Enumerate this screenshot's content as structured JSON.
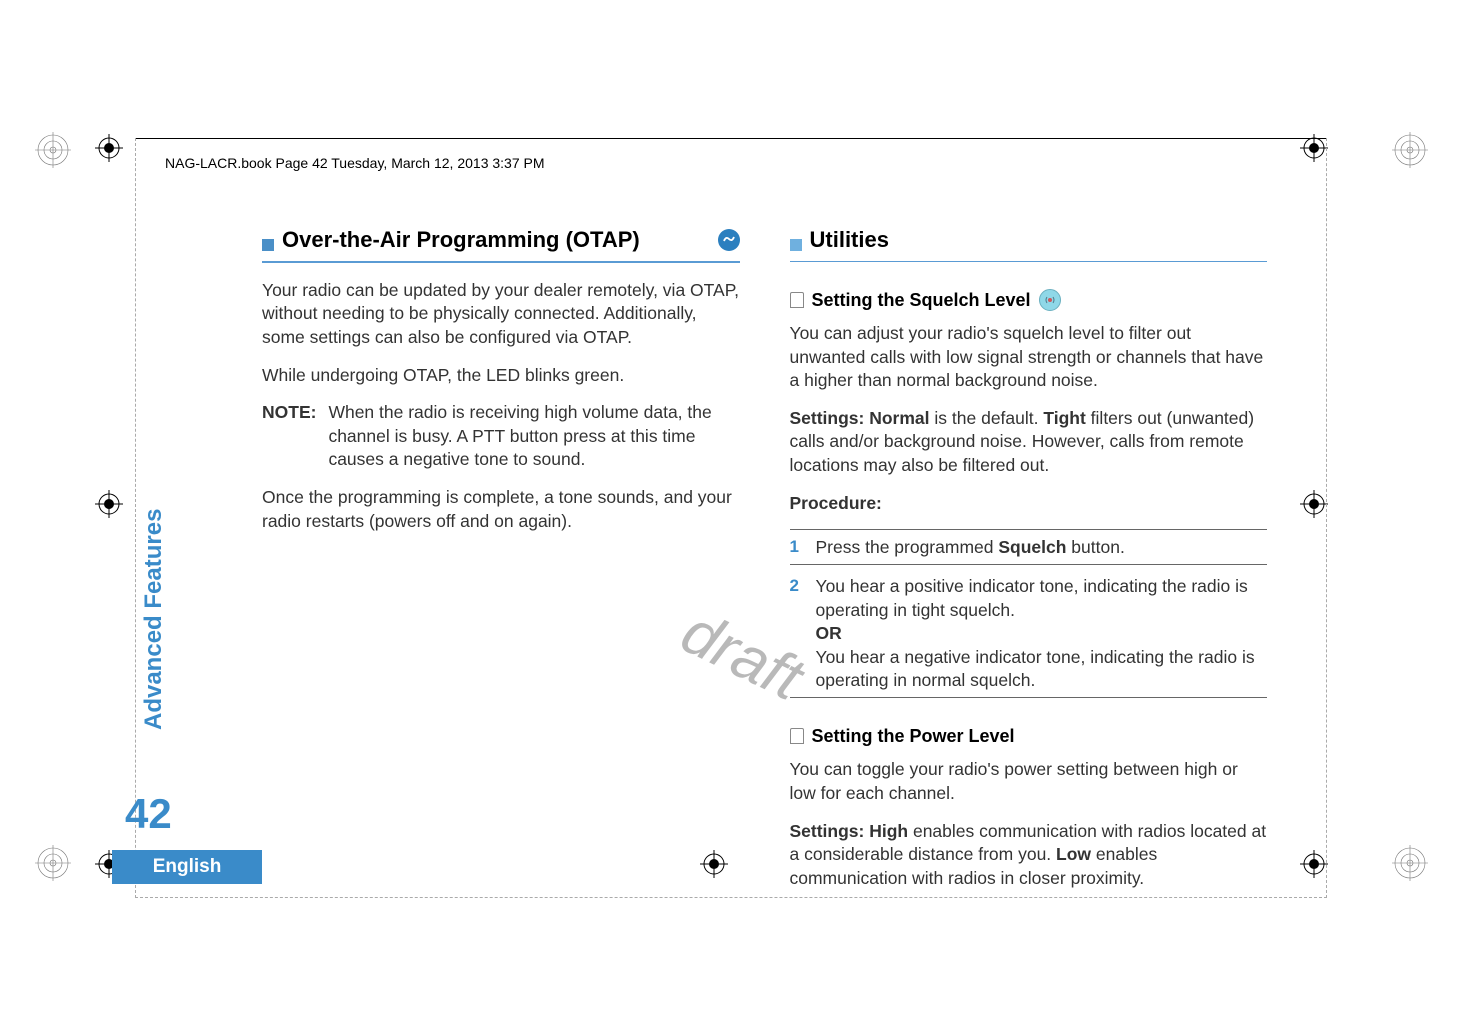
{
  "header": {
    "running_head": "NAG-LACR.book  Page 42  Tuesday, March 12, 2013  3:37 PM"
  },
  "watermark": "draft",
  "sidebar": {
    "section_label": "Advanced Features",
    "page_number": "42",
    "language": "English"
  },
  "left_column": {
    "heading": "Over-the-Air Programming (OTAP)",
    "heading_icon_name": "otap-icon",
    "p1": "Your radio can be updated by your dealer remotely, via OTAP, without needing to be physically connected. Additionally, some settings can also be configured via OTAP.",
    "p2": "While undergoing OTAP, the LED blinks green.",
    "note_label": "NOTE:",
    "note_body": "When the radio is receiving high volume data, the channel is busy. A PTT button press at this time causes a negative tone to sound.",
    "p3": "Once the programming is complete, a tone sounds, and your radio restarts (powers off and on again)."
  },
  "right_column": {
    "heading": "Utilities",
    "squelch": {
      "heading": "Setting the Squelch Level",
      "heading_icon_name": "antenna-icon",
      "p1": "You can adjust your radio's squelch level to filter out unwanted calls with low signal strength or channels that have a higher than normal background noise.",
      "p2_prefix": "Settings: Normal",
      "p2_mid1": " is the default. ",
      "p2_bold2": "Tight",
      "p2_mid2": " filters out (unwanted) calls and/or background noise. However, calls from remote locations may also be filtered out.",
      "procedure_label": "Procedure:",
      "step1_num": "1",
      "step1_a": "Press the programmed ",
      "step1_b": "Squelch",
      "step1_c": " button.",
      "step2_num": "2",
      "step2_a": "You hear a positive indicator tone, indicating the radio is operating in tight squelch.",
      "step2_or": "OR",
      "step2_b": "You hear a negative indicator tone, indicating the radio is operating in normal squelch."
    },
    "power": {
      "heading": "Setting the Power Level",
      "p1": "You can toggle your radio's power setting between high or low for each channel.",
      "p2_prefix": "Settings:  High",
      "p2_mid1": " enables communication with radios located at a considerable distance from you. ",
      "p2_bold2": "Low",
      "p2_mid2": " enables communication with radios in closer proximity."
    }
  }
}
